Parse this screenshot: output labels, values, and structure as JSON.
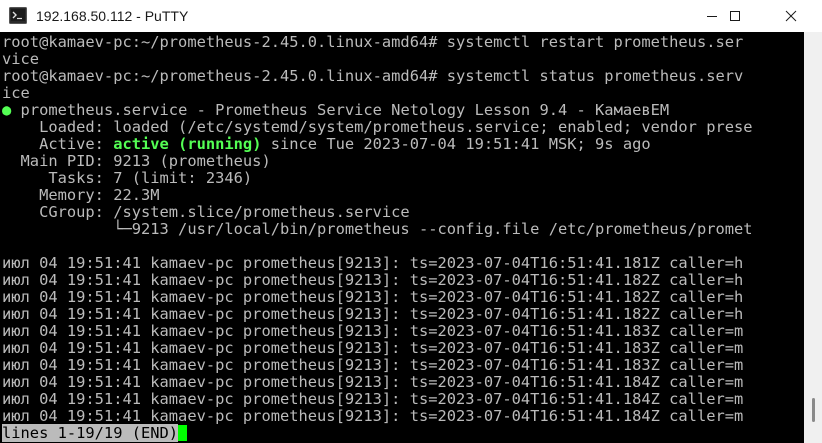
{
  "window": {
    "title": "192.168.50.112 - PuTTY",
    "icon": "putty-terminal-icon",
    "controls": [
      "minimize",
      "maximize",
      "close"
    ]
  },
  "terminal": {
    "lines": [
      "root@kamaev-pc:~/prometheus-2.45.0.linux-amd64# systemctl restart prometheus.ser",
      "vice",
      "root@kamaev-pc:~/prometheus-2.45.0.linux-amd64# systemctl status prometheus.serv",
      "ice",
      "",
      "    Loaded: loaded (/etc/systemd/system/prometheus.service; enabled; vendor prese",
      "",
      "  Main PID: 9213 (prometheus)",
      "     Tasks: 7 (limit: 2346)",
      "    Memory: 22.3M",
      "    CGroup: /system.slice/prometheus.service",
      "            └─9213 /usr/local/bin/prometheus --config.file /etc/prometheus/promet",
      "",
      "июл 04 19:51:41 kamaev-pc prometheus[9213]: ts=2023-07-04T16:51:41.181Z caller=h",
      "июл 04 19:51:41 kamaev-pc prometheus[9213]: ts=2023-07-04T16:51:41.182Z caller=h",
      "июл 04 19:51:41 kamaev-pc prometheus[9213]: ts=2023-07-04T16:51:41.182Z caller=h",
      "июл 04 19:51:41 kamaev-pc prometheus[9213]: ts=2023-07-04T16:51:41.182Z caller=h",
      "июл 04 19:51:41 kamaev-pc prometheus[9213]: ts=2023-07-04T16:51:41.183Z caller=m",
      "июл 04 19:51:41 kamaev-pc prometheus[9213]: ts=2023-07-04T16:51:41.183Z caller=m",
      "июл 04 19:51:41 kamaev-pc prometheus[9213]: ts=2023-07-04T16:51:41.183Z caller=m",
      "июл 04 19:51:41 kamaev-pc prometheus[9213]: ts=2023-07-04T16:51:41.184Z caller=m",
      "июл 04 19:51:41 kamaev-pc prometheus[9213]: ts=2023-07-04T16:51:41.184Z caller=m",
      "июл 04 19:51:41 kamaev-pc prometheus[9213]: ts=2023-07-04T16:51:41.184Z caller=m"
    ],
    "service_header": {
      "bullet": "●",
      "text": " prometheus.service - Prometheus Service Netology Lesson 9.4 - КамаевЕМ"
    },
    "active_line": {
      "prefix": "    Active: ",
      "status": "active (running)",
      "suffix": " since Tue 2023-07-04 19:51:41 MSK; 9s ago"
    },
    "pager_status": "lines 1-19/19 (END)"
  },
  "colors": {
    "background": "#000000",
    "foreground": "#bbbbbb",
    "active_green": "#54ff54",
    "cursor": "#00ff00"
  }
}
